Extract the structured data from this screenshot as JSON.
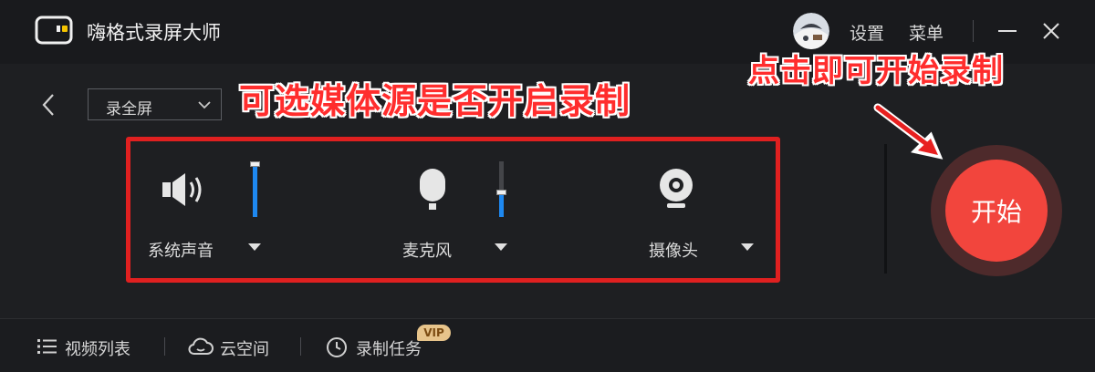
{
  "app": {
    "title": "嗨格式录屏大师",
    "settings_label": "设置",
    "menu_label": "菜单"
  },
  "mode_select": {
    "selected": "录全屏"
  },
  "sources": [
    {
      "label": "系统声音",
      "icon": "speaker-icon",
      "volume": 0.95
    },
    {
      "label": "麦克风",
      "icon": "microphone-icon",
      "volume": 0.45
    },
    {
      "label": "摄像头",
      "icon": "camera-icon"
    }
  ],
  "start_button": {
    "label": "开始"
  },
  "annotations": {
    "sources_note": "可选媒体源是否开启录制",
    "start_note": "点击即可开始录制",
    "color": "#ff2d2d"
  },
  "bottom_nav": {
    "video_list": "视频列表",
    "cloud_space": "云空间",
    "record_tasks": "录制任务",
    "vip_badge": "VIP"
  },
  "colors": {
    "accent": "#f2453d",
    "volume_fill": "#1e88f0",
    "background": "#1e1f22"
  }
}
